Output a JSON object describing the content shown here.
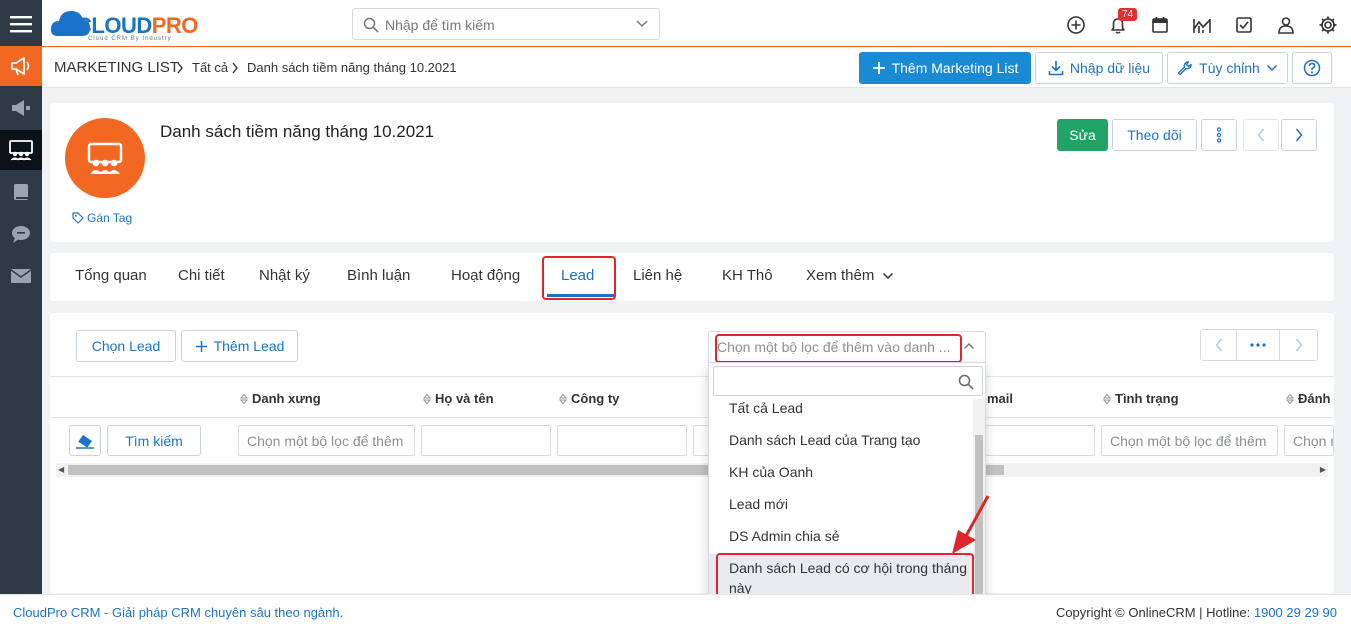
{
  "app": {
    "logo_text_a": "CLOUD",
    "logo_text_b": "PRO",
    "logo_tagline": "Cloud CRM By Industry",
    "search_placeholder": "Nhập để tìm kiếm",
    "notification_count": "74"
  },
  "breadcrumb": {
    "module": "MARKETING LIST",
    "items": [
      "Tất cả",
      "Danh sách tiềm năng tháng 10.2021"
    ]
  },
  "toolbar": {
    "add_label": "Thêm Marketing List",
    "import_label": "Nhập dữ liệu",
    "customize_label": "Tùy chỉnh"
  },
  "record": {
    "title": "Danh sách tiềm năng tháng 10.2021",
    "tag_label": "Gán Tag",
    "edit_label": "Sửa",
    "follow_label": "Theo dõi"
  },
  "tabs": {
    "items": [
      "Tổng quan",
      "Chi tiết",
      "Nhật ký",
      "Bình luận",
      "Hoạt động",
      "Lead",
      "Liên hệ",
      "KH Thô",
      "Xem thêm"
    ],
    "active": "Lead"
  },
  "related": {
    "select_lead_label": "Chọn Lead",
    "add_lead_label": "Thêm Lead",
    "search_label": "Tìm kiếm",
    "columns": [
      "Danh xưng",
      "Họ và tên",
      "Công ty",
      "mail",
      "Tình trạng",
      "Đánh"
    ],
    "filter_placeholder": "Chọn một bộ lọc để thêm",
    "filter_placeholder_short": "Chọn m"
  },
  "dropdown": {
    "placeholder": "Chọn một bộ lọc để thêm vào danh ...",
    "options": [
      "Tất cả Lead",
      "Danh sách Lead của Trang tạo",
      "KH của Oanh",
      "Lead mới",
      "DS Admin chia sẻ",
      "Danh sách Lead có cơ hội trong tháng này"
    ],
    "selected": "Danh sách Lead có cơ hội trong tháng này"
  },
  "footer": {
    "left": "CloudPro CRM - Giải pháp CRM chuyên sâu theo ngành.",
    "right": "Copyright © OnlineCRM | Hotline: ",
    "hotline": "1900 29 29 90"
  },
  "colors": {
    "brand_orange": "#f26722",
    "brand_blue": "#1a73c8",
    "primary_button": "#1a8ad4",
    "edit_green": "#21a366",
    "highlight_red": "#e0262b",
    "rail_dark": "#2e3a45"
  }
}
